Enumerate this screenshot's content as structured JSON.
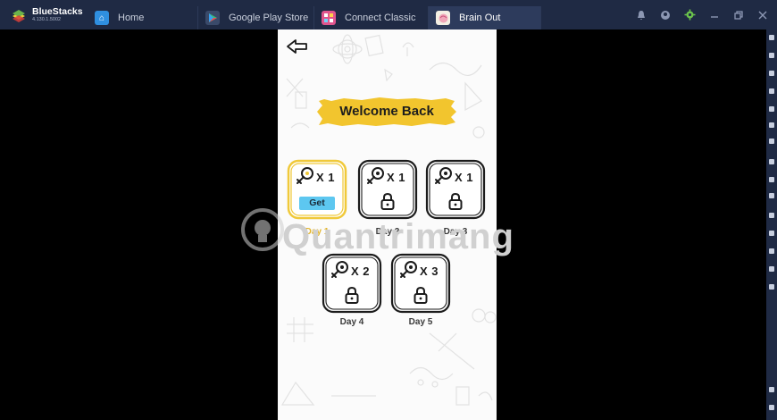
{
  "titlebar": {
    "brand": {
      "name": "BlueStacks",
      "version": "4.130.1.5002"
    },
    "tabs": [
      {
        "label": "Home",
        "icon": "home-icon",
        "active": false
      },
      {
        "label": "Google Play Store",
        "icon": "play-store-icon",
        "active": false
      },
      {
        "label": "Connect Classic",
        "icon": "connect-classic-icon",
        "active": false
      },
      {
        "label": "Brain Out",
        "icon": "brain-out-icon",
        "active": true
      }
    ],
    "system_icons": [
      "notification-bell-icon",
      "account-icon",
      "settings-gear-icon",
      "minimize-icon",
      "restore-icon",
      "close-icon"
    ]
  },
  "game": {
    "banner_title": "Welcome Back",
    "get_label": "Get",
    "days": [
      {
        "label": "Day 1",
        "multiplier": "X 1",
        "state": "available"
      },
      {
        "label": "Day 2",
        "multiplier": "X 1",
        "state": "locked"
      },
      {
        "label": "Day 3",
        "multiplier": "X 1",
        "state": "locked"
      },
      {
        "label": "Day 4",
        "multiplier": "X 2",
        "state": "locked"
      },
      {
        "label": "Day 5",
        "multiplier": "X 3",
        "state": "locked"
      }
    ]
  },
  "watermark": {
    "text": "Quantrimang"
  },
  "colors": {
    "titlebar_bg": "#1f2a44",
    "active_tab_bg": "#2d3b5c",
    "banner_yellow": "#f2c52e",
    "active_card_yellow": "#f0c93a",
    "get_button_blue": "#5dc7f0",
    "phone_bg": "#fbfbfb"
  }
}
